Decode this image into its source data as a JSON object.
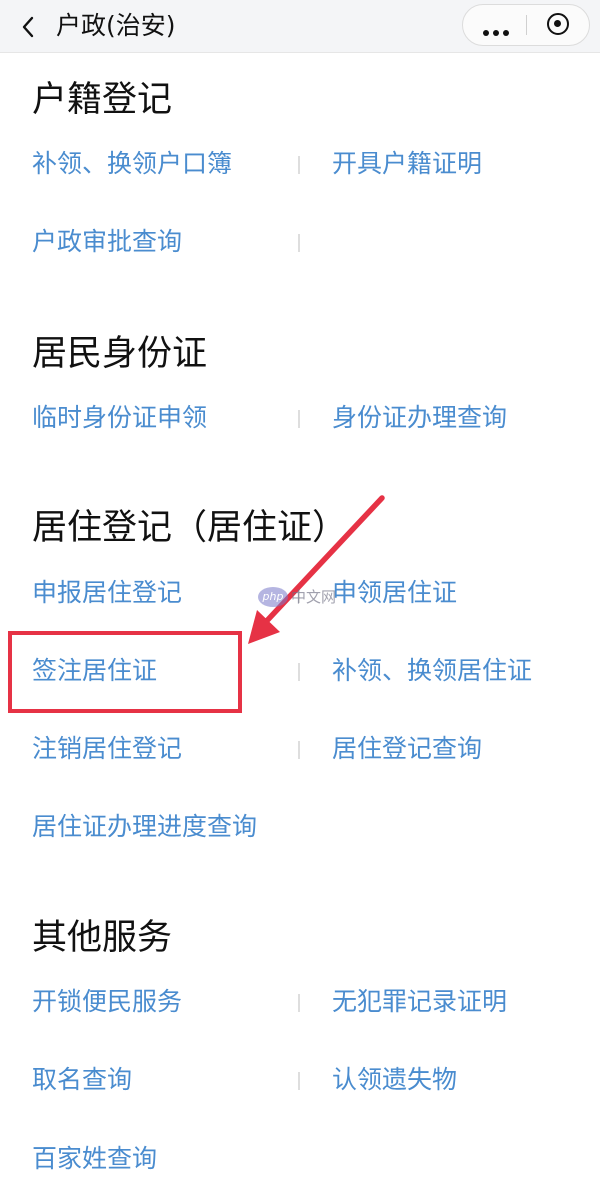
{
  "nav": {
    "title": "户政(治安)"
  },
  "sections": [
    {
      "title": "户籍登记",
      "items": [
        "补领、换领户口簿",
        "开具户籍证明",
        "户政审批查询"
      ]
    },
    {
      "title": "居民身份证",
      "items": [
        "临时身份证申领",
        "身份证办理查询"
      ]
    },
    {
      "title": "居住登记（居住证）",
      "items": [
        "申报居住登记",
        "申领居住证",
        "签注居住证",
        "补领、换领居住证",
        "注销居住登记",
        "居住登记查询",
        "居住证办理进度查询"
      ]
    },
    {
      "title": "其他服务",
      "items": [
        "开锁便民服务",
        "无犯罪记录证明",
        "取名查询",
        "认领遗失物",
        "百家姓查询"
      ]
    }
  ],
  "annotation": {
    "color": "#e63245",
    "highlighted_item": "签注居住证"
  },
  "watermark": {
    "logo_text": "php",
    "text": "中文网"
  },
  "colors": {
    "link": "#4a8ccf",
    "title": "#111111",
    "nav_background": "#f4f5f7"
  },
  "icons": [
    "back-icon",
    "more-dots-icon",
    "target-icon",
    "red-arrow-icon"
  ]
}
